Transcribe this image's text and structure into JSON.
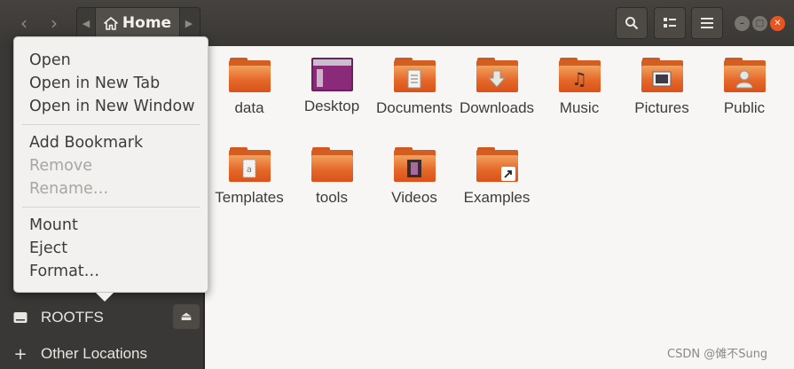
{
  "header": {
    "back_icon": "chevron-left-icon",
    "forward_icon": "chevron-right-icon",
    "path_label": "Home",
    "search_icon": "search-icon",
    "view_icon": "list-view-icon",
    "menu_icon": "hamburger-menu-icon"
  },
  "sidebar": {
    "rows": [
      {
        "label": "ROOTFS",
        "icon": "drive-icon"
      },
      {
        "label": "Other Locations",
        "icon": "plus-icon"
      }
    ]
  },
  "menu": {
    "items": [
      {
        "label": "Open",
        "enabled": true
      },
      {
        "label": "Open in New Tab",
        "enabled": true
      },
      {
        "label": "Open in New Window",
        "enabled": true
      },
      {
        "label": "Add Bookmark",
        "enabled": true
      },
      {
        "label": "Remove",
        "enabled": false
      },
      {
        "label": "Rename…",
        "enabled": false
      },
      {
        "label": "Mount",
        "enabled": true
      },
      {
        "label": "Eject",
        "enabled": true
      },
      {
        "label": "Format…",
        "enabled": true
      }
    ]
  },
  "files": [
    {
      "name": "data",
      "icon": "folder-icon"
    },
    {
      "name": "Desktop",
      "icon": "desktop-folder-icon"
    },
    {
      "name": "Documents",
      "icon": "documents-folder-icon"
    },
    {
      "name": "Downloads",
      "icon": "downloads-folder-icon"
    },
    {
      "name": "Music",
      "icon": "music-folder-icon"
    },
    {
      "name": "Pictures",
      "icon": "pictures-folder-icon"
    },
    {
      "name": "Public",
      "icon": "public-folder-icon"
    },
    {
      "name": "Templates",
      "icon": "templates-folder-icon"
    },
    {
      "name": "tools",
      "icon": "folder-icon"
    },
    {
      "name": "Videos",
      "icon": "videos-folder-icon"
    },
    {
      "name": "Examples",
      "icon": "link-folder-icon"
    }
  ],
  "colors": {
    "accent": "#e95420",
    "folder": "#e5682a",
    "sidebar_bg": "#3a3836"
  },
  "watermark": "CSDN @傩不Sung"
}
